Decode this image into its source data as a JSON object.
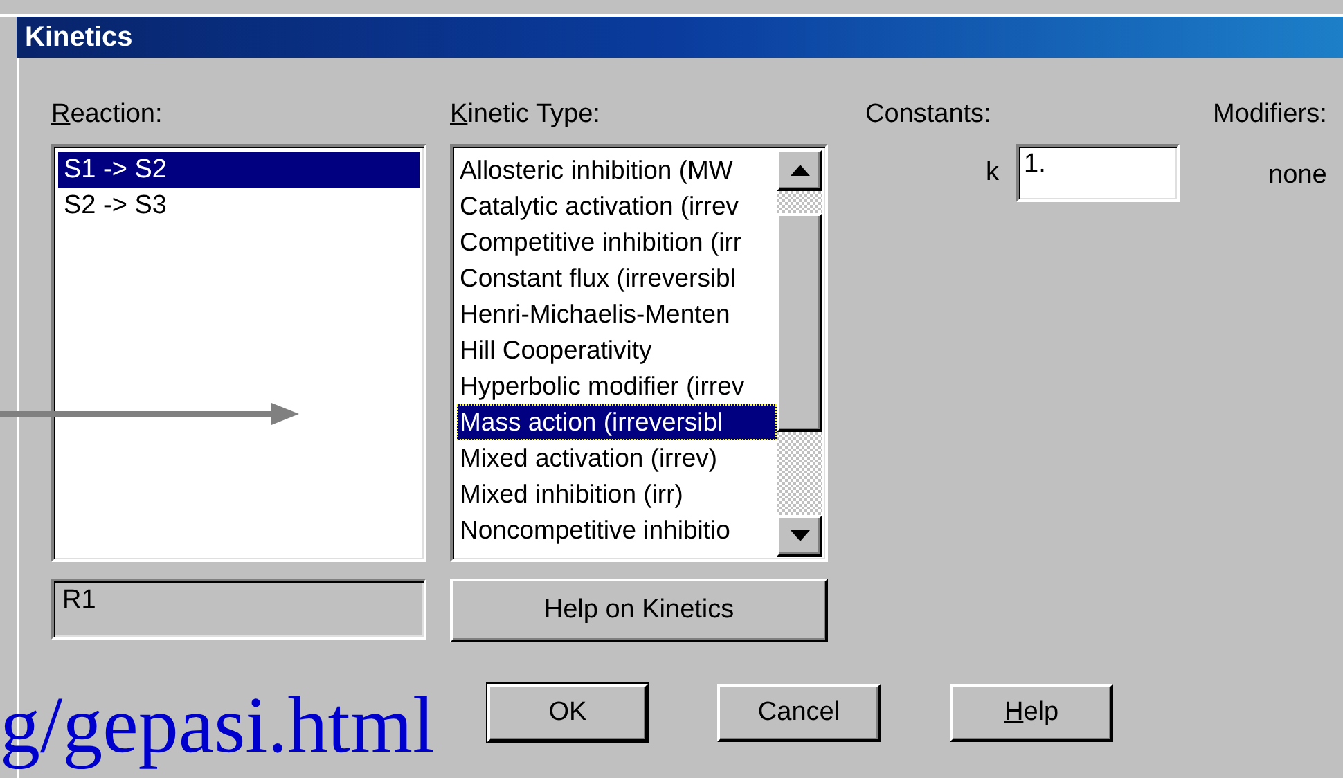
{
  "window": {
    "title": "Kinetics"
  },
  "reaction": {
    "label": "Reaction:",
    "access_key_underlined": true,
    "items": [
      {
        "label": "S1 -> S2",
        "selected": true
      },
      {
        "label": "S2 -> S3",
        "selected": false
      }
    ],
    "name_field": {
      "value": "R1",
      "disabled": true
    }
  },
  "kinetic_type": {
    "label": "Kinetic Type:",
    "access_key_underlined": true,
    "items": [
      {
        "label": "Allosteric inhibition (MW",
        "selected": false
      },
      {
        "label": "Catalytic activation (irrev",
        "selected": false
      },
      {
        "label": "Competitive inhibition (irr",
        "selected": false
      },
      {
        "label": "Constant flux (irreversibl",
        "selected": false
      },
      {
        "label": "Henri-Michaelis-Menten",
        "selected": false
      },
      {
        "label": "Hill Cooperativity",
        "selected": false
      },
      {
        "label": "Hyperbolic modifier (irrev",
        "selected": false
      },
      {
        "label": "Mass action (irreversibl",
        "selected": true
      },
      {
        "label": "Mixed activation (irrev)",
        "selected": false
      },
      {
        "label": "Mixed inhibition (irr)",
        "selected": false
      },
      {
        "label": "Noncompetitive inhibitio",
        "selected": false
      }
    ],
    "help_button": "Help on Kinetics"
  },
  "constants": {
    "label": "Constants:",
    "items": [
      {
        "name": "k",
        "value": "1."
      }
    ]
  },
  "modifiers": {
    "label": "Modifiers:",
    "value": "none"
  },
  "buttons": [
    {
      "label": "OK",
      "default": true,
      "access_key_underlined": false
    },
    {
      "label": "Cancel",
      "default": false,
      "access_key_underlined": false
    },
    {
      "label": "Help",
      "default": false,
      "access_key_underlined": true
    }
  ],
  "overlay_link": "g/gepasi.html"
}
